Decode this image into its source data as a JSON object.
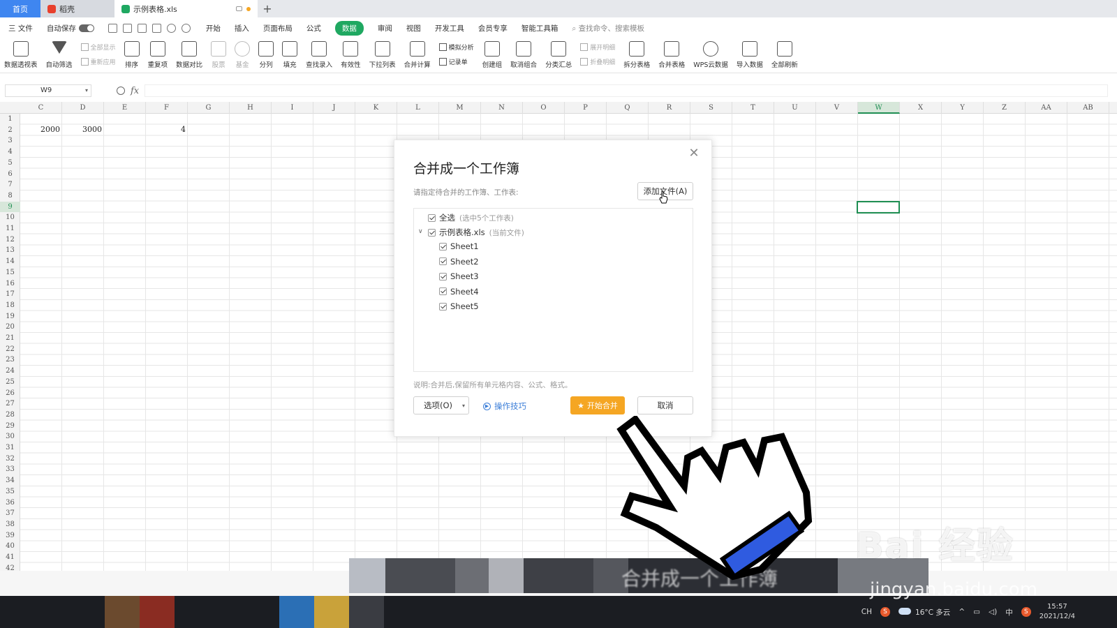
{
  "tabs": {
    "home": "首页",
    "file1": "稻壳",
    "file2": "示例表格.xls"
  },
  "menu": {
    "file": "三 文件",
    "autosave": "自动保存",
    "items": [
      "开始",
      "插入",
      "页面布局",
      "公式",
      "数据",
      "审阅",
      "视图",
      "开发工具",
      "会员专享",
      "智能工具箱"
    ],
    "active_index": 4,
    "search_placeholder": "查找命令、搜索模板"
  },
  "ribbon": {
    "pivot": "数据透视表",
    "autofilter": "自动筛选",
    "show_all": "全部显示",
    "reapply": "重新应用",
    "sort": "排序",
    "dup": "重复项",
    "compare": "数据对比",
    "stock": "股票",
    "fund": "基金",
    "split": "分列",
    "fill": "填充",
    "lookup": "查找录入",
    "validity": "有效性",
    "dropdown": "下拉列表",
    "consolidate": "合并计算",
    "simulate": "模拟分析",
    "record": "记录单",
    "group": "创建组",
    "ungroup": "取消组合",
    "subtotal": "分类汇总",
    "expand": "展开明细",
    "collapse": "折叠明细",
    "splittable": "拆分表格",
    "mergetable": "合并表格",
    "wpscloud": "WPS云数据",
    "import": "导入数据",
    "refresh": "全部刷新"
  },
  "formula_bar": {
    "cell_ref": "W9",
    "fx": "fx"
  },
  "grid": {
    "columns": [
      "C",
      "D",
      "E",
      "F",
      "G",
      "H",
      "I",
      "J",
      "K",
      "L",
      "M",
      "N",
      "O",
      "P",
      "Q",
      "R",
      "S",
      "T",
      "U",
      "V",
      "W",
      "X",
      "Y",
      "Z",
      "AA",
      "AB"
    ],
    "selected_column": "W",
    "rows": [
      "1",
      "2",
      "3",
      "4",
      "5",
      "6",
      "7",
      "8",
      "9",
      "10",
      "11",
      "12",
      "13",
      "14",
      "15",
      "16",
      "17",
      "18",
      "19",
      "20",
      "21",
      "22",
      "23",
      "24",
      "25",
      "26",
      "27",
      "28",
      "29",
      "30",
      "31",
      "32",
      "33",
      "34",
      "35",
      "36",
      "37",
      "38",
      "39",
      "40",
      "41",
      "42"
    ],
    "selected_row": "9",
    "values": {
      "C2": "2000",
      "D2": "3000",
      "F2": "4"
    }
  },
  "dialog": {
    "title": "合并成一个工作簿",
    "hint": "请指定待合并的工作簿、工作表:",
    "add_file": "添加文件(A)",
    "select_all": "全选",
    "select_all_sub": "(选中5个工作表)",
    "workbook": "示例表格.xls",
    "workbook_sub": "(当前文件)",
    "sheets": [
      "Sheet1",
      "Sheet2",
      "Sheet3",
      "Sheet4",
      "Sheet5"
    ],
    "note": "说明:合并后,保留所有单元格内容、公式、格式。",
    "options": "选项(O)",
    "tips": "操作技巧",
    "start": "开始合并",
    "cancel": "取消"
  },
  "taskbar": {
    "weather": "16°C 多云",
    "time": "15:57",
    "date": "2021/12/4",
    "ime": "中",
    "lang": "CH"
  },
  "watermark": {
    "brand": "Bai 经验",
    "url": "jingyan.baidu.com"
  },
  "subtitle": "合并成一个工作簿"
}
